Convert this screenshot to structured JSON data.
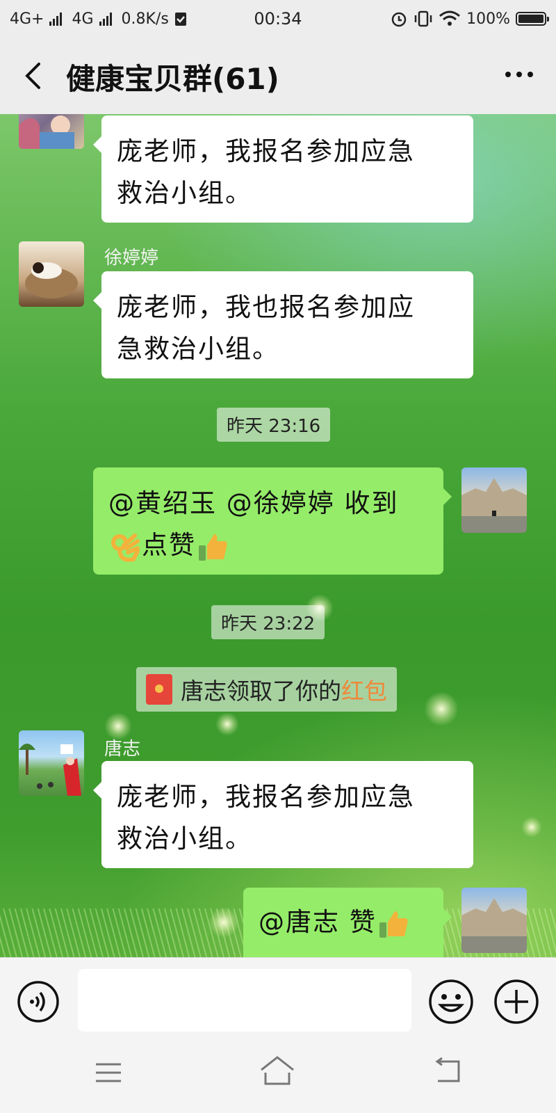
{
  "status_bar": {
    "network_1": "4G+",
    "network_2": "4G",
    "speed": "0.8K/s",
    "time": "00:34",
    "battery": "100%"
  },
  "header": {
    "title": "健康宝贝群(61)",
    "back_icon": "chevron-left-icon",
    "more_icon": "more-dots-icon"
  },
  "messages": [
    {
      "side": "left",
      "sender": "",
      "text_line1": "庞老师，我报名参加应急",
      "text_line2": "救治小组。"
    },
    {
      "side": "left",
      "sender": "徐婷婷",
      "text_line1": "庞老师，我也报名参加应",
      "text_line2": "急救治小组。"
    },
    {
      "type": "time",
      "text": "昨天 23:16"
    },
    {
      "side": "right",
      "text_line1": "@黄绍玉 @徐婷婷  收到",
      "text_line2": "点赞"
    },
    {
      "type": "time",
      "text": "昨天 23:22"
    },
    {
      "type": "notice",
      "text": "唐志领取了你的",
      "link": "红包"
    },
    {
      "side": "left",
      "sender": "唐志",
      "text_line1": "庞老师，我报名参加应急",
      "text_line2": "救治小组。"
    },
    {
      "side": "right",
      "text_line1": "@唐志  赞"
    }
  ],
  "input_bar": {
    "voice_icon": "voice-icon",
    "input_value": "",
    "emoji_icon": "emoji-icon",
    "plus_icon": "plus-icon"
  },
  "nav_bar": {
    "menu_icon": "menu-icon",
    "home_icon": "home-icon",
    "back_icon": "back-icon"
  },
  "colors": {
    "bubble_left": "#ffffff",
    "bubble_right": "#95ec69",
    "link_orange": "#f0883a",
    "redpacket": "#e6453a"
  }
}
